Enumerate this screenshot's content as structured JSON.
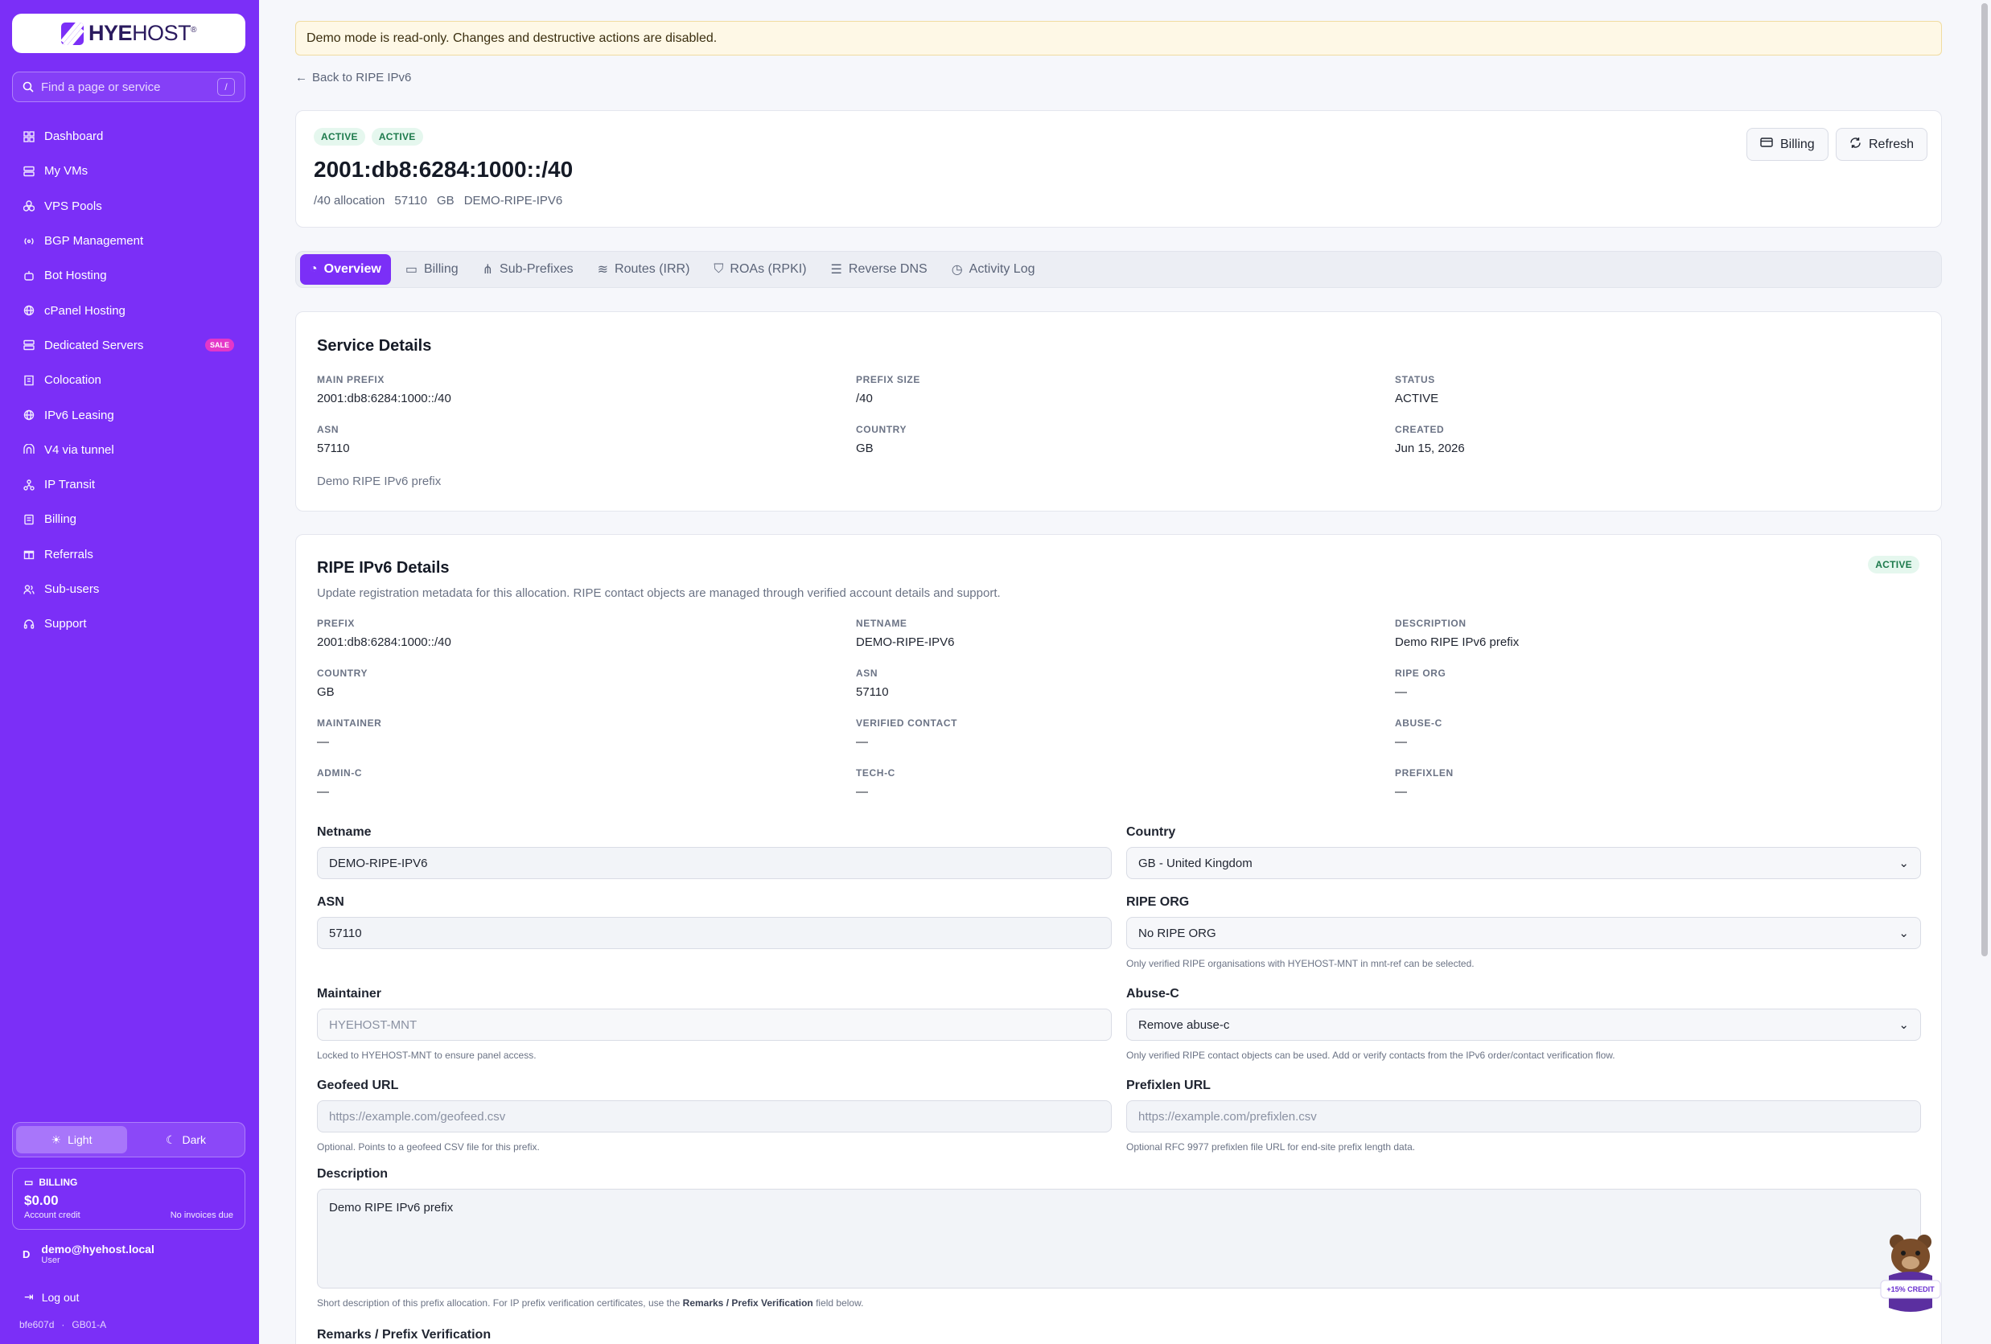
{
  "brand": {
    "logo_bold": "HYE",
    "logo_rest": "HOST",
    "logo_tm": "®"
  },
  "sidebar": {
    "search_placeholder": "Find a page or service",
    "search_shortcut": "/",
    "items": [
      {
        "label": "Dashboard",
        "icon": "grid-icon"
      },
      {
        "label": "My VMs",
        "icon": "server-icon"
      },
      {
        "label": "VPS Pools",
        "icon": "cubes-icon"
      },
      {
        "label": "BGP Management",
        "icon": "radio-icon"
      },
      {
        "label": "Bot Hosting",
        "icon": "bot-icon"
      },
      {
        "label": "cPanel Hosting",
        "icon": "globe-icon"
      },
      {
        "label": "Dedicated Servers",
        "icon": "server-icon",
        "badge": "SALE"
      },
      {
        "label": "Colocation",
        "icon": "building-icon"
      },
      {
        "label": "IPv6 Leasing",
        "icon": "globe-icon"
      },
      {
        "label": "V4 via tunnel",
        "icon": "tunnel-icon"
      },
      {
        "label": "IP Transit",
        "icon": "network-icon"
      },
      {
        "label": "Billing",
        "icon": "receipt-icon"
      },
      {
        "label": "Referrals",
        "icon": "gift-icon"
      },
      {
        "label": "Sub-users",
        "icon": "users-icon"
      },
      {
        "label": "Support",
        "icon": "headset-icon"
      }
    ],
    "theme": {
      "light": "Light",
      "dark": "Dark"
    },
    "billing": {
      "label": "BILLING",
      "amount": "$0.00",
      "credit_label": "Account credit",
      "invoices": "No invoices due"
    },
    "user": {
      "initial": "D",
      "email": "demo@hyehost.local",
      "role": "User"
    },
    "logout": "Log out",
    "build": "bfe607d",
    "node": "GB01-A"
  },
  "banner": "Demo mode is read-only. Changes and destructive actions are disabled.",
  "back_link": "Back to RIPE IPv6",
  "header": {
    "badges": [
      "ACTIVE",
      "ACTIVE"
    ],
    "title": "2001:db8:6284:1000::/40",
    "meta": [
      "/40 allocation",
      "57110",
      "GB",
      "DEMO-RIPE-IPV6"
    ],
    "billing_btn": "Billing",
    "refresh_btn": "Refresh"
  },
  "tabs": [
    {
      "label": "Overview",
      "icon": "gauge-icon"
    },
    {
      "label": "Billing",
      "icon": "card-icon"
    },
    {
      "label": "Sub-Prefixes",
      "icon": "tree-icon"
    },
    {
      "label": "Routes (IRR)",
      "icon": "layers-icon"
    },
    {
      "label": "ROAs (RPKI)",
      "icon": "shield-icon"
    },
    {
      "label": "Reverse DNS",
      "icon": "server-icon"
    },
    {
      "label": "Activity Log",
      "icon": "clock-icon"
    }
  ],
  "service_details": {
    "title": "Service Details",
    "fields": [
      {
        "label": "MAIN PREFIX",
        "value": "2001:db8:6284:1000::/40"
      },
      {
        "label": "PREFIX SIZE",
        "value": "/40"
      },
      {
        "label": "STATUS",
        "value": "ACTIVE"
      },
      {
        "label": "ASN",
        "value": "57110"
      },
      {
        "label": "COUNTRY",
        "value": "GB"
      },
      {
        "label": "CREATED",
        "value": "Jun 15, 2026"
      }
    ],
    "note": "Demo RIPE IPv6 prefix"
  },
  "ripe": {
    "title": "RIPE IPv6 Details",
    "status": "ACTIVE",
    "subtitle": "Update registration metadata for this allocation. RIPE contact objects are managed through verified account details and support.",
    "fields": [
      {
        "label": "PREFIX",
        "value": "2001:db8:6284:1000::/40"
      },
      {
        "label": "NETNAME",
        "value": "DEMO-RIPE-IPV6"
      },
      {
        "label": "DESCRIPTION",
        "value": "Demo RIPE IPv6 prefix"
      },
      {
        "label": "COUNTRY",
        "value": "GB"
      },
      {
        "label": "ASN",
        "value": "57110"
      },
      {
        "label": "RIPE ORG",
        "value": "—"
      },
      {
        "label": "MAINTAINER",
        "value": "—"
      },
      {
        "label": "VERIFIED CONTACT",
        "value": "—"
      },
      {
        "label": "ABUSE-C",
        "value": "—"
      },
      {
        "label": "ADMIN-C",
        "value": "—"
      },
      {
        "label": "TECH-C",
        "value": "—"
      },
      {
        "label": "PREFIXLEN",
        "value": "—"
      }
    ],
    "form": {
      "netname_label": "Netname",
      "netname_value": "DEMO-RIPE-IPV6",
      "country_label": "Country",
      "country_value": "GB - United Kingdom",
      "asn_label": "ASN",
      "asn_value": "57110",
      "org_label": "RIPE ORG",
      "org_value": "No RIPE ORG",
      "org_hint": "Only verified RIPE organisations with HYEHOST-MNT in mnt-ref can be selected.",
      "mnt_label": "Maintainer",
      "mnt_value": "HYEHOST-MNT",
      "mnt_hint": "Locked to HYEHOST-MNT to ensure panel access.",
      "abuse_label": "Abuse-C",
      "abuse_value": "Remove abuse-c",
      "abuse_hint": "Only verified RIPE contact objects can be used. Add or verify contacts from the IPv6 order/contact verification flow.",
      "geofeed_label": "Geofeed URL",
      "geofeed_placeholder": "https://example.com/geofeed.csv",
      "geofeed_hint": "Optional. Points to a geofeed CSV file for this prefix.",
      "prefixlen_label": "Prefixlen URL",
      "prefixlen_placeholder": "https://example.com/prefixlen.csv",
      "prefixlen_hint": "Optional RFC 9977 prefixlen file URL for end-site prefix length data.",
      "desc_label": "Description",
      "desc_value": "Demo RIPE IPv6 prefix",
      "desc_hint_pre": "Short description of this prefix allocation. For IP prefix verification certificates, use the ",
      "desc_hint_bold": "Remarks / Prefix Verification",
      "desc_hint_post": " field below.",
      "remarks_label": "Remarks / Prefix Verification"
    }
  },
  "promo": {
    "text": "+15% CREDIT"
  },
  "colors": {
    "accent": "#7b2ff7",
    "active_bg": "#e5f7ee",
    "active_fg": "#1d7a4c",
    "banner_bg": "#fef8e6"
  }
}
